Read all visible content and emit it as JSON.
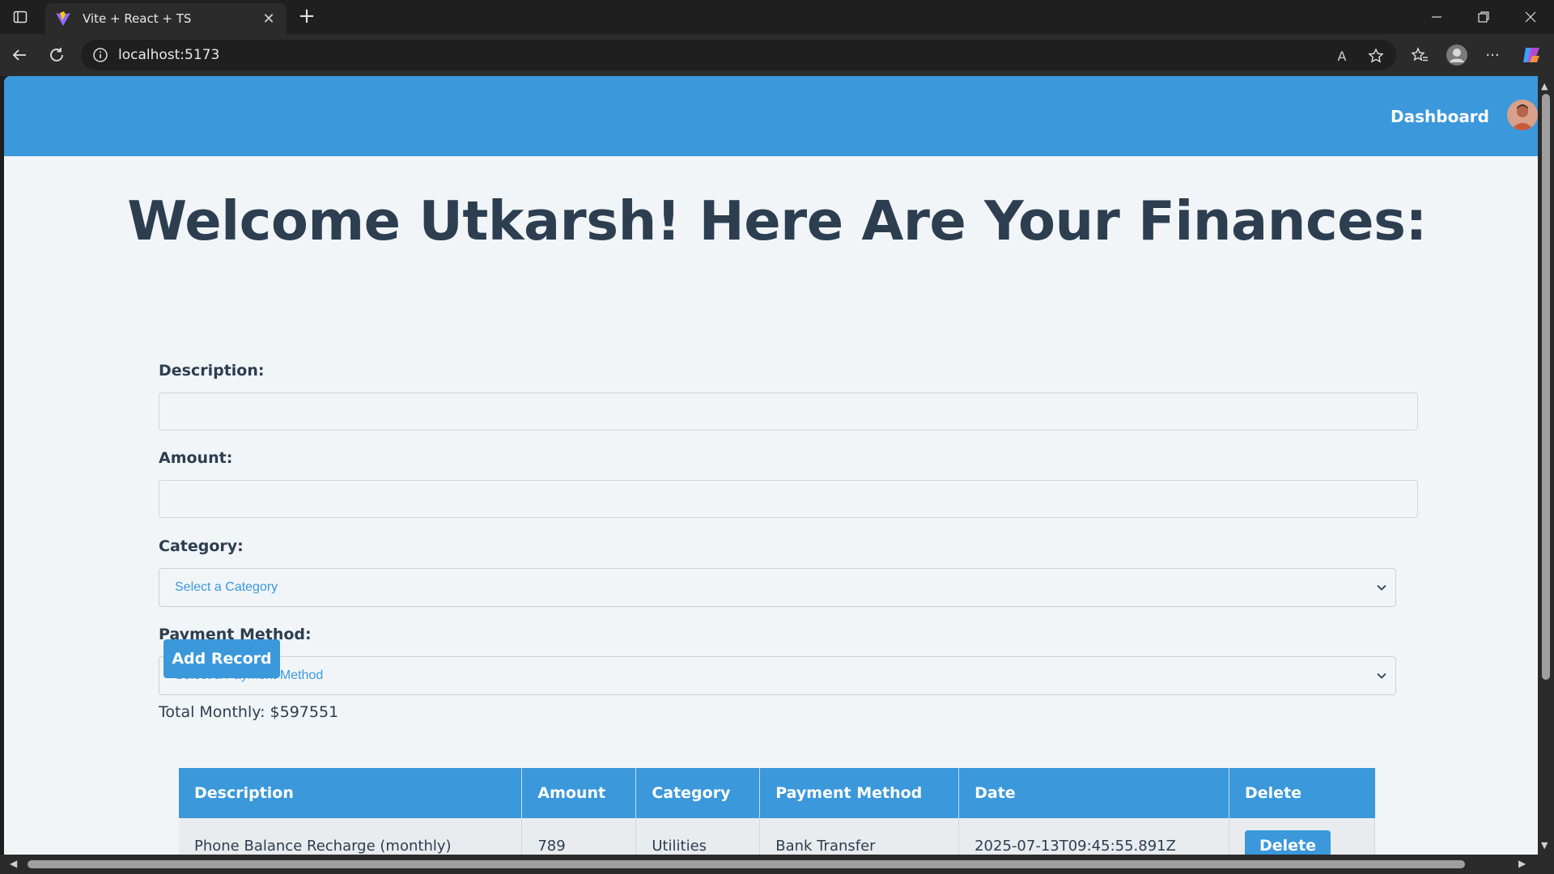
{
  "browser": {
    "tab_title": "Vite + React + TS",
    "address": "localhost:5173",
    "icons": [
      "sidebar-icon",
      "vite-favicon",
      "close-icon",
      "plus-icon",
      "minimize-icon",
      "restore-icon",
      "window-close-icon",
      "back-icon",
      "reload-icon",
      "info-icon",
      "read-aloud-icon",
      "star-icon",
      "favorites-icon",
      "profile-icon",
      "more-icon",
      "copilot-icon"
    ],
    "new_tab_glyph": "+",
    "tab_close_glyph": "✕",
    "read_aloud_glyph": "A",
    "more_glyph": "···"
  },
  "navbar": {
    "dashboard_label": "Dashboard",
    "avatar_icon": "user-avatar"
  },
  "main": {
    "title": "Welcome Utkarsh! Here Are Your Finances:",
    "form": {
      "description_label": "Description:",
      "description_value": "",
      "amount_label": "Amount:",
      "amount_value": "",
      "category_label": "Category:",
      "category_selected": "Select a Category",
      "payment_label": "Payment Method:",
      "payment_selected": "Select a Payment Method",
      "submit_label": "Add Record"
    },
    "total_monthly": "Total Monthly: $597551",
    "table": {
      "columns": [
        "Description",
        "Amount",
        "Category",
        "Payment Method",
        "Date",
        "Delete"
      ],
      "rows": [
        {
          "description": "Phone Balance Recharge (monthly)",
          "amount": "789",
          "category": "Utilities",
          "payment_method": "Bank Transfer",
          "date": "2025-07-13T09:45:55.891Z",
          "delete_label": "Delete"
        }
      ]
    }
  },
  "colors": {
    "accent": "#3a98db",
    "heading": "#2c3e50",
    "page_bg": "#f2f5f8"
  }
}
